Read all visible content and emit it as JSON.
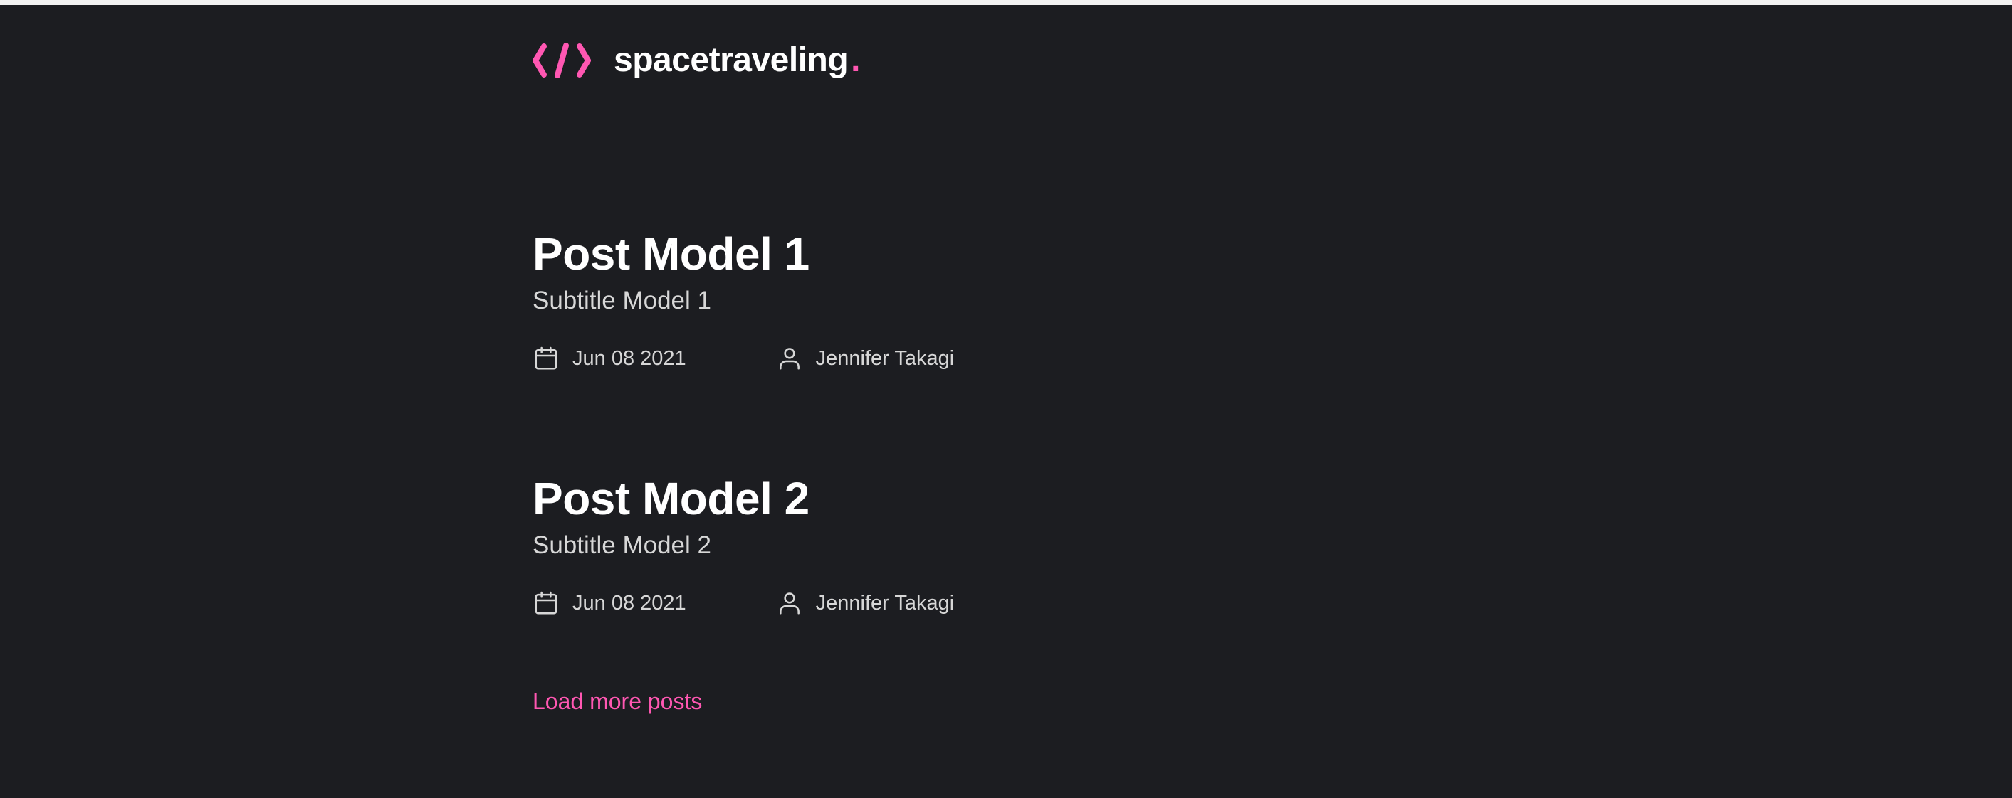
{
  "header": {
    "brand": "spacetraveling",
    "brand_dot": ".",
    "logo_icon": "code-brackets-icon",
    "accent_color": "#ff57b2"
  },
  "posts": [
    {
      "title": "Post Model 1",
      "subtitle": "Subtitle Model 1",
      "date": "Jun 08 2021",
      "author": "Jennifer Takagi"
    },
    {
      "title": "Post Model 2",
      "subtitle": "Subtitle Model 2",
      "date": "Jun 08 2021",
      "author": "Jennifer Takagi"
    }
  ],
  "icons": {
    "date": "calendar-icon",
    "author": "user-icon"
  },
  "load_more_label": "Load more posts",
  "colors": {
    "background": "#1c1d21",
    "text": "#ffffff",
    "muted_text": "#d7d7d7",
    "accent": "#ff57b2"
  }
}
